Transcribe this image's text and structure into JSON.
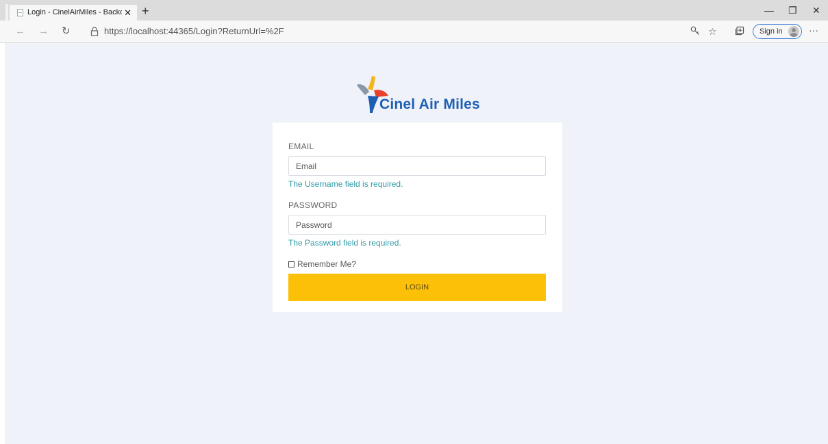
{
  "browser": {
    "tab_title": "Login - CinelAirMiles - Backoffice",
    "tab_close": "✕",
    "new_tab": "+",
    "url_host": "https://localhost",
    "url_rest": ":44365/Login?ReturnUrl=%2F",
    "sign_in_label": "Sign in",
    "more_label": "···",
    "minimize": "—",
    "restore": "❐",
    "close": "✕"
  },
  "brand": {
    "name": "Cinel Air Miles",
    "colors": {
      "blue": "#1f5fb2",
      "red": "#e9402b",
      "gold": "#f5b41c",
      "gray": "#8a97a6"
    }
  },
  "form": {
    "email_label": "EMAIL",
    "email_placeholder": "Email",
    "email_error": "The Username field is required.",
    "password_label": "PASSWORD",
    "password_placeholder": "Password",
    "password_error": "The Password field is required.",
    "remember_label": "Remember Me?",
    "login_button": "LOGIN"
  },
  "colors": {
    "page_bg": "#eff2f9",
    "accent_button": "#fcc008",
    "error_text": "#2f9aa6"
  }
}
